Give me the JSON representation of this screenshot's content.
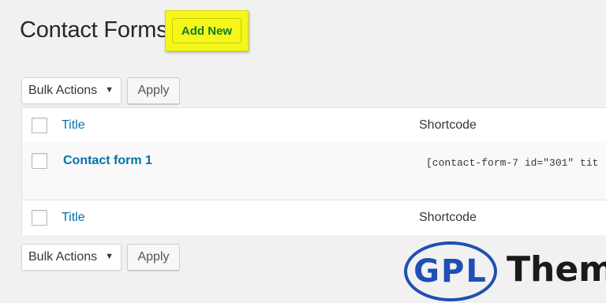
{
  "header": {
    "title": "Contact Forms",
    "add_new_label": "Add New"
  },
  "bulk_top": {
    "select_value": "Bulk Actions",
    "apply_label": "Apply"
  },
  "table": {
    "columns": {
      "title": "Title",
      "shortcode": "Shortcode"
    },
    "rows": [
      {
        "title": "Contact form 1",
        "shortcode": "[contact-form-7 id=\"301\" tit"
      }
    ],
    "footer_columns": {
      "title": "Title",
      "shortcode": "Shortcode"
    }
  },
  "bulk_bottom": {
    "select_value": "Bulk Actions",
    "apply_label": "Apply"
  },
  "watermark": {
    "badge": "GPL",
    "word": "Them"
  },
  "colors": {
    "highlight": "#f4f719",
    "link": "#0073aa",
    "watermark_blue": "#1f4fb4"
  },
  "icons": {
    "select_arrow": "caret-down-icon"
  }
}
